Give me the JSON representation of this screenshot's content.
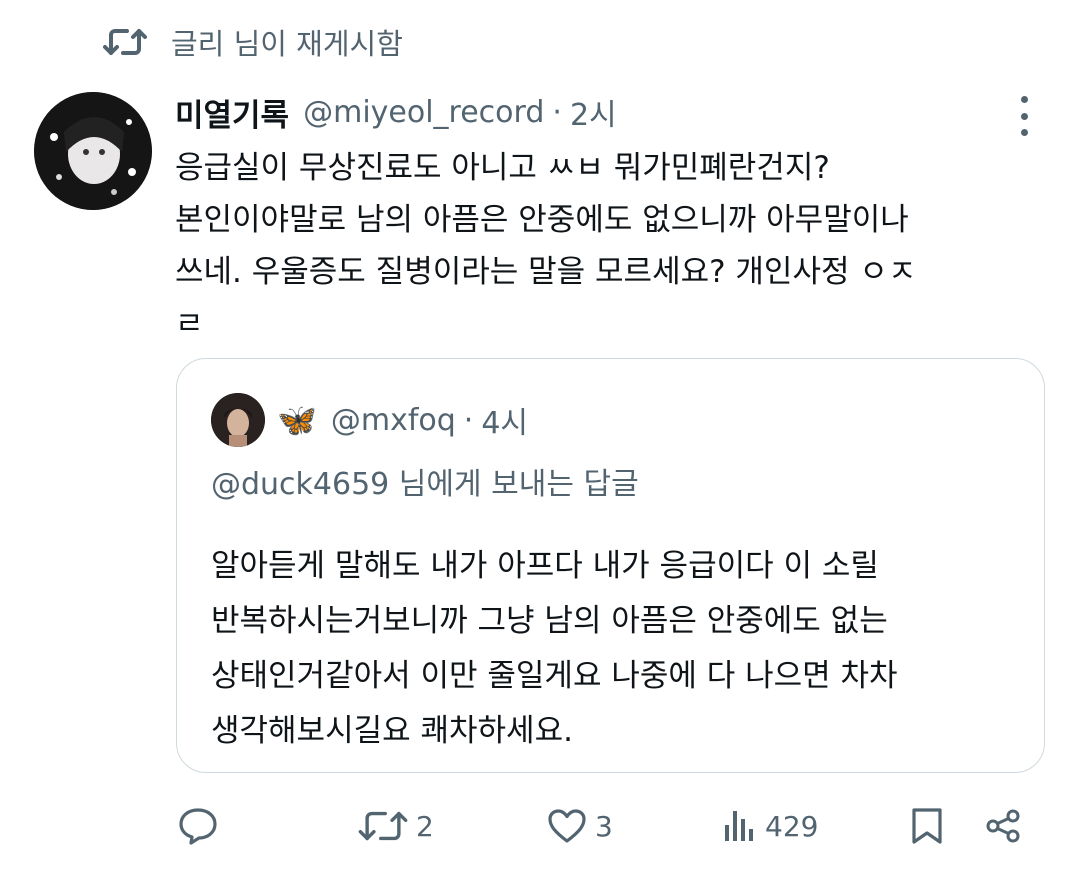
{
  "retweet": {
    "icon": "retweet-icon",
    "text": "글리 님이 재게시함"
  },
  "tweet": {
    "name": "미열기록",
    "handle": "@miyeol_record",
    "separator": "·",
    "time": "2시",
    "body_lines": [
      "응급실이 무상진료도 아니고 ㅆㅂ 뭐가민폐란건지?",
      "본인이야말로 남의 아픔은 안중에도 없으니까 아무말이나",
      "쓰네. 우울증도 질병이라는 말을 모르세요?  개인사정 ㅇㅈ",
      "ㄹ"
    ]
  },
  "quote": {
    "emoji": "🦋",
    "handle": "@mxfoq",
    "separator": "·",
    "time": "4시",
    "reply_to": "@duck4659 님에게 보내는 답글",
    "body_lines": [
      "알아듣게 말해도 내가 아프다 내가 응급이다 이 소릴",
      "반복하시는거보니까 그냥 남의 아픔은 안중에도 없는",
      "상태인거같아서 이만 줄일게요  나중에 다 나으면 차차",
      "생각해보시길요 쾌차하세요."
    ]
  },
  "actions": {
    "reply": {
      "icon": "reply-icon",
      "count": ""
    },
    "retweet": {
      "icon": "retweet-icon",
      "count": "2"
    },
    "like": {
      "icon": "heart-icon",
      "count": "3"
    },
    "views": {
      "icon": "views-icon",
      "count": "429"
    },
    "bookmark": {
      "icon": "bookmark-icon"
    },
    "share": {
      "icon": "share-icon"
    }
  },
  "colors": {
    "text": "#0f1419",
    "secondary": "#536471",
    "border": "#cfd9de"
  }
}
